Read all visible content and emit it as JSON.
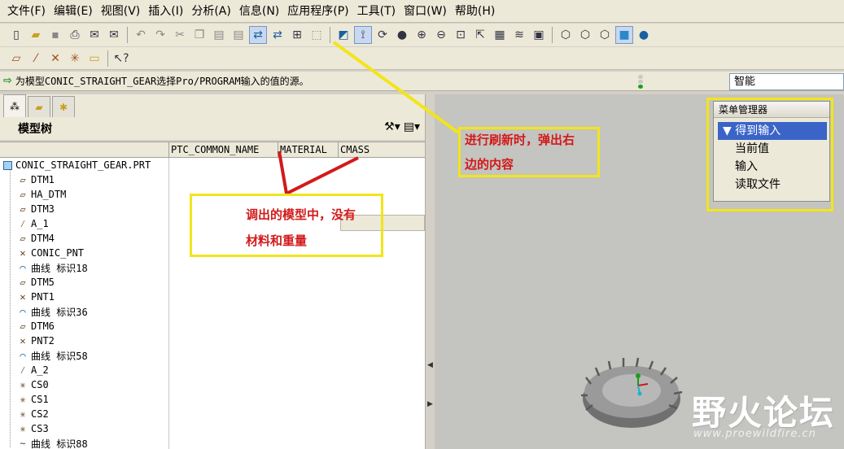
{
  "menubar": {
    "items": [
      "文件(F)",
      "编辑(E)",
      "视图(V)",
      "插入(I)",
      "分析(A)",
      "信息(N)",
      "应用程序(P)",
      "工具(T)",
      "窗口(W)",
      "帮助(H)"
    ]
  },
  "toolbar_row1": {
    "icons": [
      "new-file-icon",
      "open-folder-icon",
      "save-icon",
      "print-icon",
      "email-icon",
      "email-link-icon",
      "undo-icon",
      "redo-icon",
      "cut-icon",
      "copy-icon",
      "paste-icon",
      "paste-special-icon",
      "regenerate-icon",
      "regenerate-manager-icon",
      "find-icon",
      "select-box-icon",
      "repaint-icon",
      "spin-center-icon",
      "orient-mode-icon",
      "shading-icon",
      "zoom-in-icon",
      "zoom-out-icon",
      "refit-icon",
      "reorient-icon",
      "saved-views-icon",
      "layers-icon",
      "view-manager-icon",
      "wireframe-icon",
      "hidden-line-icon",
      "no-hidden-icon",
      "shaded-icon",
      "enhanced-realism-icon"
    ]
  },
  "toolbar_row2": {
    "icons": [
      "datum-plane-icon",
      "datum-axis-icon",
      "datum-point-icon",
      "csys-icon",
      "annotation-icon",
      "whats-this-icon"
    ]
  },
  "message": {
    "text": "为模型CONIC_STRAIGHT_GEAR选择Pro/PROGRAM输入的值的源。"
  },
  "filter": {
    "value": "智能"
  },
  "model_tree": {
    "title": "模型树",
    "columns": [
      "PTC_COMMON_NAME",
      "MATERIAL",
      "CMASS"
    ],
    "root": "CONIC_STRAIGHT_GEAR.PRT",
    "items": [
      {
        "label": "DTM1",
        "icon": "datum-plane-icon"
      },
      {
        "label": "HA_DTM",
        "icon": "datum-plane-icon"
      },
      {
        "label": "DTM3",
        "icon": "datum-plane-icon"
      },
      {
        "label": "A_1",
        "icon": "datum-axis-icon"
      },
      {
        "label": "DTM4",
        "icon": "datum-plane-icon"
      },
      {
        "label": "CONIC_PNT",
        "icon": "datum-point-icon"
      },
      {
        "label": "曲线 标识18",
        "icon": "curve-icon"
      },
      {
        "label": "DTM5",
        "icon": "datum-plane-icon"
      },
      {
        "label": "PNT1",
        "icon": "datum-point-icon"
      },
      {
        "label": "曲线 标识36",
        "icon": "curve-icon"
      },
      {
        "label": "DTM6",
        "icon": "datum-plane-icon"
      },
      {
        "label": "PNT2",
        "icon": "datum-point-icon"
      },
      {
        "label": "曲线 标识58",
        "icon": "curve-icon"
      },
      {
        "label": "A_2",
        "icon": "datum-axis-icon"
      },
      {
        "label": "CS0",
        "icon": "csys-icon"
      },
      {
        "label": "CS1",
        "icon": "csys-icon"
      },
      {
        "label": "CS2",
        "icon": "csys-icon"
      },
      {
        "label": "CS3",
        "icon": "csys-icon"
      },
      {
        "label": "曲线 标识88",
        "icon": "sketch-curve-icon"
      }
    ]
  },
  "menu_manager": {
    "title": "菜单管理器",
    "selected": "得到输入",
    "options": [
      "当前值",
      "输入",
      "读取文件"
    ]
  },
  "annotations": {
    "refresh_note": [
      "进行刷新时，弹出右",
      "边的内容"
    ],
    "material_note": [
      "调出的模型中，没有",
      "材料和重量"
    ]
  },
  "watermark": {
    "text": "野火论坛",
    "url": "www.proewildfire.cn"
  },
  "colors": {
    "annotation_yellow": "#f2e51a",
    "annotation_red": "#d21a1a",
    "selection_blue": "#3a64c8",
    "viewport_gray": "#c4c4c0"
  }
}
